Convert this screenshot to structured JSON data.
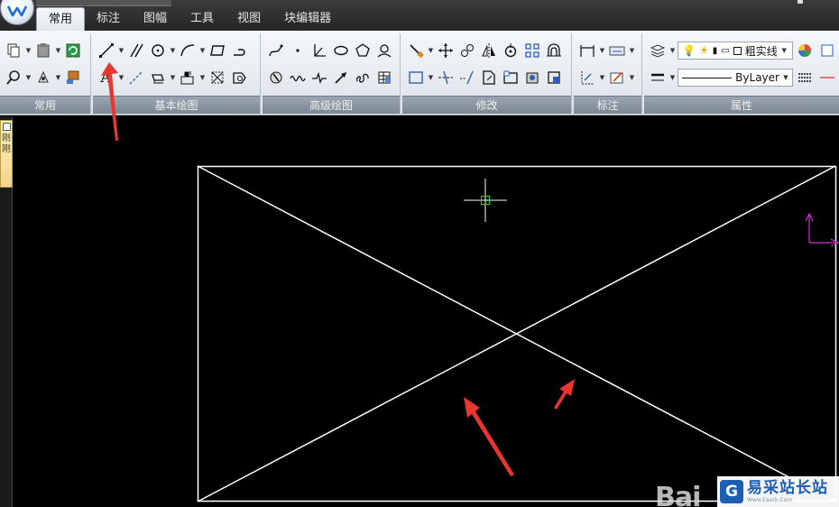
{
  "tabs": [
    {
      "label": "常用",
      "active": true
    },
    {
      "label": "标注",
      "active": false
    },
    {
      "label": "图幅",
      "active": false
    },
    {
      "label": "工具",
      "active": false
    },
    {
      "label": "视图",
      "active": false
    },
    {
      "label": "块编辑器",
      "active": false
    }
  ],
  "panels": {
    "common": {
      "title": "常用"
    },
    "basic_draw": {
      "title": "基本绘图"
    },
    "advanced_draw": {
      "title": "高级绘图"
    },
    "modify": {
      "title": "修改"
    },
    "dimension": {
      "title": "标注"
    },
    "properties": {
      "title": "属性"
    }
  },
  "properties": {
    "linetype_label": "粗实线",
    "layer_label": "ByLayer"
  },
  "tools": {
    "text_glyph": "A"
  },
  "tool_palette": {
    "label": "刚刚"
  },
  "colors": {
    "canvas_background": "#000000",
    "drawing_lines": "#ffffff",
    "crosshair": "#ffffff",
    "cursor_box": "#33cc33",
    "ucs_icon": "#cc33cc",
    "annotation_arrows": "#e8352f"
  },
  "watermark": {
    "baidu_text": "Bai",
    "site_logo": "G",
    "site_name": "易采站长站",
    "site_url": "Www.Easck.Com"
  }
}
